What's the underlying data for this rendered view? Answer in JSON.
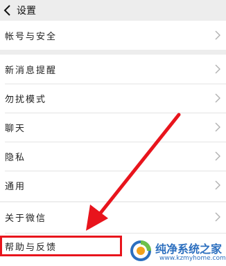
{
  "header": {
    "title": "设置"
  },
  "groups": [
    {
      "items": [
        {
          "label": "帐号与安全"
        }
      ]
    },
    {
      "items": [
        {
          "label": "新消息提醒"
        },
        {
          "label": "勿扰模式"
        },
        {
          "label": "聊天"
        },
        {
          "label": "隐私"
        },
        {
          "label": "通用"
        }
      ]
    },
    {
      "items": [
        {
          "label": "关于微信"
        },
        {
          "label": "帮助与反馈"
        }
      ]
    }
  ],
  "annotation": {
    "color": "#e8141c"
  },
  "watermark": {
    "title": "纯净系统之家",
    "url": "www.kzmyhome.com"
  }
}
